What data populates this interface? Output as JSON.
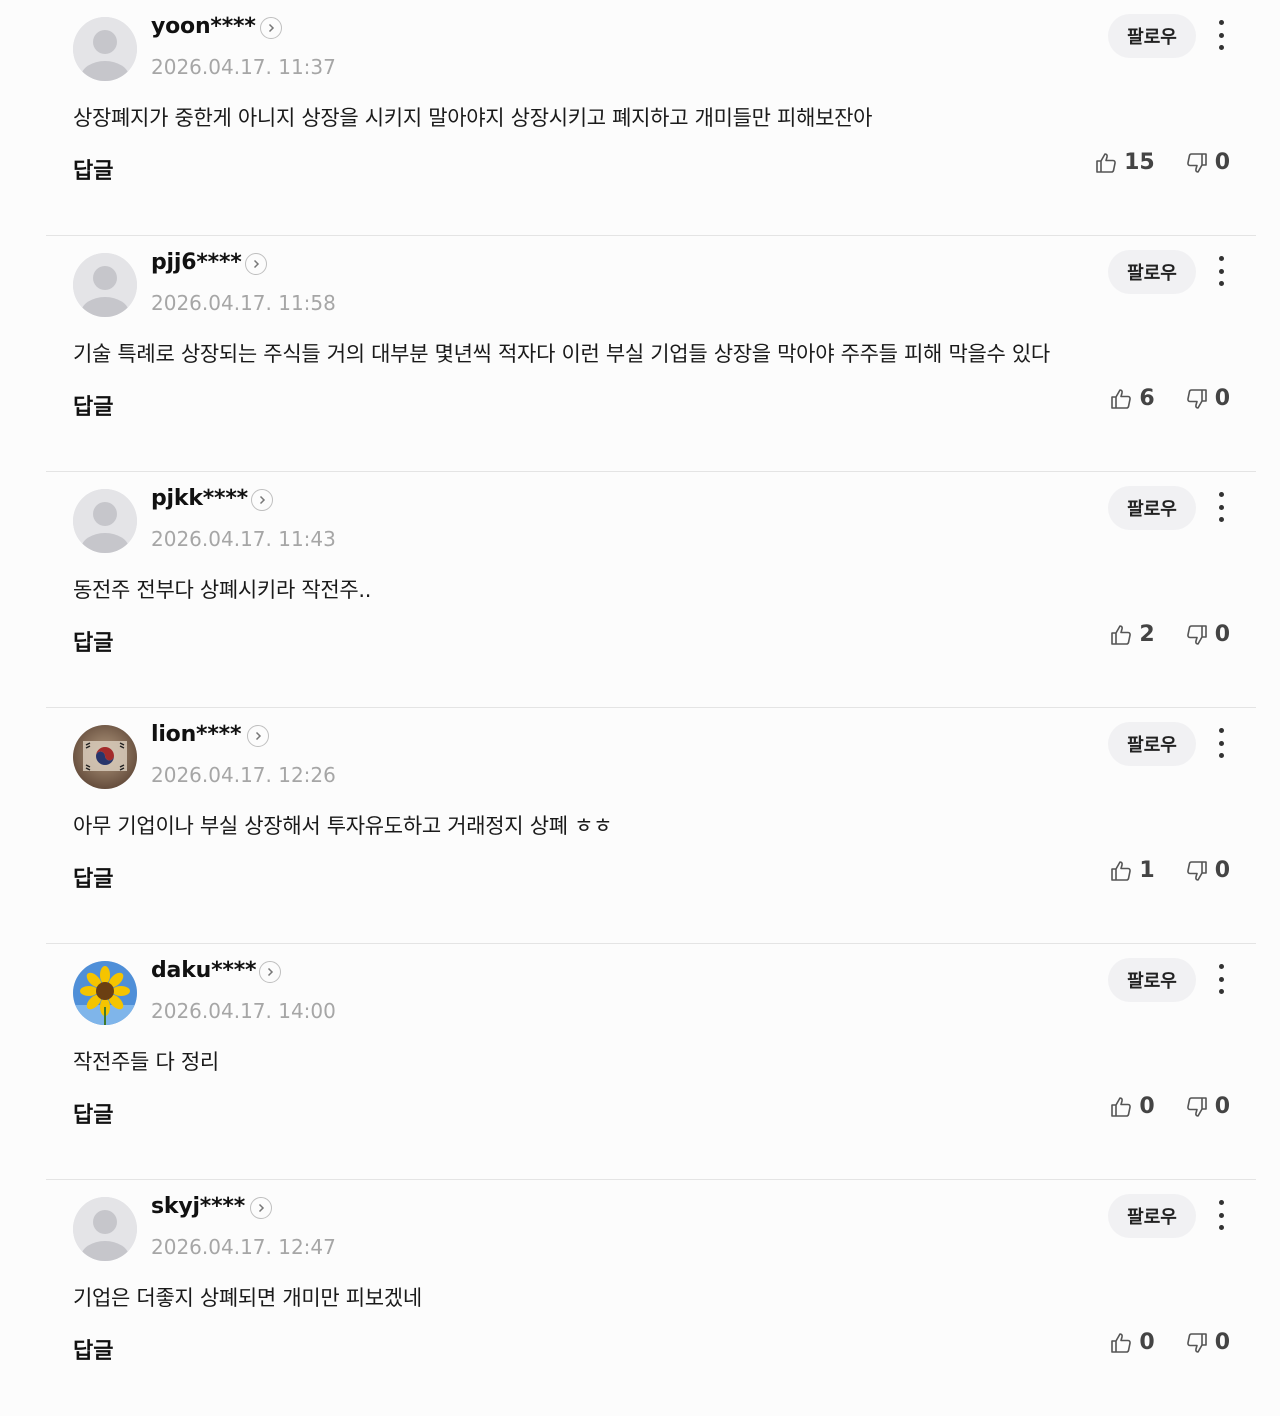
{
  "labels": {
    "follow": "팔로우",
    "reply": "답글"
  },
  "comments": [
    {
      "username": "yoon****",
      "timestamp": "2026.04.17. 11:37",
      "text": "상장폐지가 중한게 아니지 상장을 시키지 말아야지 상장시키고 폐지하고 개미들만 피해보잔아",
      "likes": "15",
      "dislikes": "0",
      "avatar": "default"
    },
    {
      "username": "pjj6****",
      "timestamp": "2026.04.17. 11:58",
      "text": "기술 특례로 상장되는 주식들 거의 대부분 몇년씩 적자다 이런 부실 기업들 상장을 막아야 주주들 피해 막을수 있다",
      "likes": "6",
      "dislikes": "0",
      "avatar": "default"
    },
    {
      "username": "pjkk****",
      "timestamp": "2026.04.17. 11:43",
      "text": "동전주 전부다 상폐시키라 작전주..",
      "likes": "2",
      "dislikes": "0",
      "avatar": "default"
    },
    {
      "username": "lion****",
      "timestamp": "2026.04.17. 12:26",
      "text": "아무 기업이나 부실 상장해서 투자유도하고 거래정지 상폐 ㅎㅎ",
      "likes": "1",
      "dislikes": "0",
      "avatar": "taegeukgi"
    },
    {
      "username": "daku****",
      "timestamp": "2026.04.17. 14:00",
      "text": "작전주들 다 정리",
      "likes": "0",
      "dislikes": "0",
      "avatar": "sunflower"
    },
    {
      "username": "skyj****",
      "timestamp": "2026.04.17. 12:47",
      "text": "기업은 더좋지 상폐되면 개미만 피보겠네",
      "likes": "0",
      "dislikes": "0",
      "avatar": "default"
    }
  ]
}
